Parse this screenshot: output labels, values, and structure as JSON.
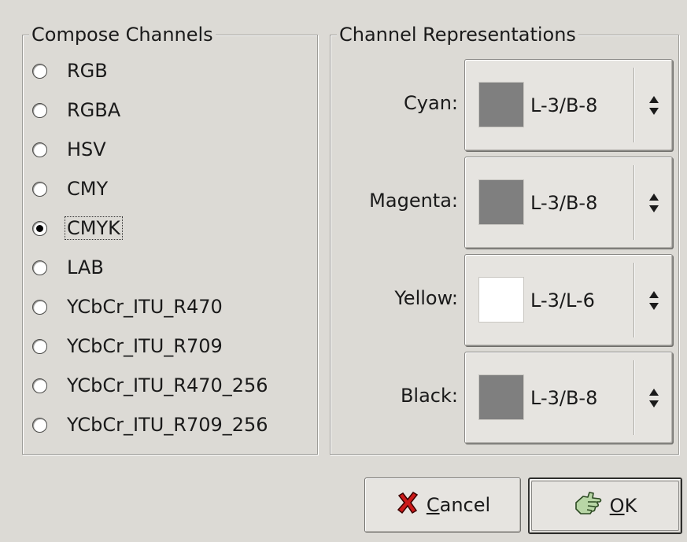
{
  "compose": {
    "title": "Compose Channels",
    "options": [
      {
        "label": "RGB",
        "checked": false
      },
      {
        "label": "RGBA",
        "checked": false
      },
      {
        "label": "HSV",
        "checked": false
      },
      {
        "label": "CMY",
        "checked": false
      },
      {
        "label": "CMYK",
        "checked": true
      },
      {
        "label": "LAB",
        "checked": false
      },
      {
        "label": "YCbCr_ITU_R470",
        "checked": false
      },
      {
        "label": "YCbCr_ITU_R709",
        "checked": false
      },
      {
        "label": "YCbCr_ITU_R470_256",
        "checked": false
      },
      {
        "label": "YCbCr_ITU_R709_256",
        "checked": false
      }
    ]
  },
  "representations": {
    "title": "Channel Representations",
    "channels": [
      {
        "label": "Cyan:",
        "value": "L-3/B-8",
        "swatch": "#7f7f7f"
      },
      {
        "label": "Magenta:",
        "value": "L-3/B-8",
        "swatch": "#7f7f7f"
      },
      {
        "label": "Yellow:",
        "value": "L-3/L-6",
        "swatch": "#ffffff"
      },
      {
        "label": "Black:",
        "value": "L-3/B-8",
        "swatch": "#7f7f7f"
      }
    ]
  },
  "buttons": {
    "cancel": {
      "mnemonic": "C",
      "rest": "ancel",
      "icon": "cancel-x-icon"
    },
    "ok": {
      "mnemonic": "O",
      "rest": "K",
      "icon": "ok-hand-icon"
    }
  }
}
